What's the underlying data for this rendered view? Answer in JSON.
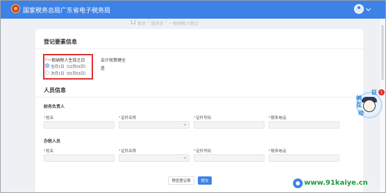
{
  "header": {
    "title": "国家税务总局广东省电子税务局",
    "emblem_icon": "tax-emblem-icon",
    "avatar_icon": "user-avatar-icon"
  },
  "breadcrumb": {
    "home_icon": "home-icon",
    "items": [
      "首页",
      "/",
      "服务办",
      "/",
      "一般纳税人登记"
    ]
  },
  "registration": {
    "section_title": "登记要素信息",
    "effective_date_label": "一般纳税人生效之日",
    "options": [
      {
        "label": "当月1日（12月01日）",
        "selected": true
      },
      {
        "label": "次月1日（01月01日）",
        "selected": false
      }
    ],
    "accounting_label": "会计核算健全",
    "accounting_value": "是"
  },
  "personnel": {
    "section_title": "人员信息",
    "finance_title": "财务负责人",
    "handler_title": "办税人员",
    "fields": {
      "name_label": "姓名",
      "id_type_label": "证件名称",
      "id_number_label": "证件号码",
      "phone_label": "联系电话"
    },
    "finance": {
      "name_value": "",
      "id_type_value": "",
      "id_number_value": "",
      "phone_value": ""
    },
    "handler": {
      "name_value": "",
      "id_type_value": "",
      "id_number_value": "",
      "phone_value": ""
    }
  },
  "actions": {
    "preview_label": "预览登记表",
    "submit_label": "提交"
  },
  "assistant": {
    "icon": "assistant-avatar-icon",
    "chars": [
      "征",
      "纳",
      "互",
      "动"
    ],
    "badge": "1"
  },
  "watermark": {
    "text": "www.91kaiye.cn",
    "icon": "watermark-logo-icon"
  },
  "colors": {
    "brand_blue": "#3d82e6",
    "highlight_red": "#e02f2f",
    "watermark_green": "#1a9a3c"
  }
}
